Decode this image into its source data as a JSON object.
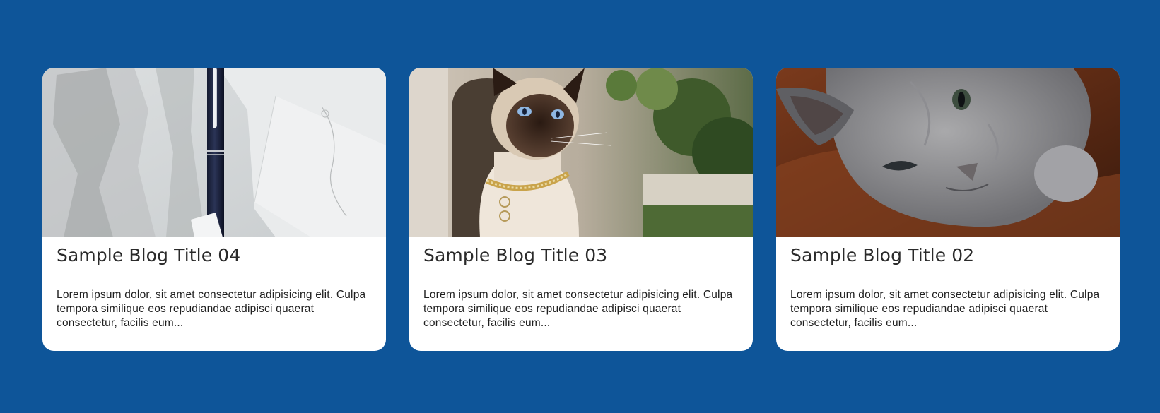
{
  "posts": [
    {
      "title": "Sample Blog Title 04",
      "excerpt": "Lorem ipsum dolor, sit amet consectetur adipisicing elit. Culpa tempora similique eos repudiandae adipisci quaerat consectetur, facilis eum...",
      "image": "pen-on-paper-photo"
    },
    {
      "title": "Sample Blog Title 03",
      "excerpt": "Lorem ipsum dolor, sit amet consectetur adipisicing elit. Culpa tempora similique eos repudiandae adipisci quaerat consectetur, facilis eum...",
      "image": "siamese-cat-photo"
    },
    {
      "title": "Sample Blog Title 02",
      "excerpt": "Lorem ipsum dolor, sit amet consectetur adipisicing elit. Culpa tempora similique eos repudiandae adipisci quaerat consectetur, facilis eum...",
      "image": "gray-cat-photo"
    }
  ],
  "colors": {
    "background": "#0e5599",
    "card": "#ffffff",
    "title": "#2a2a2a",
    "text": "#1f1f1f"
  }
}
